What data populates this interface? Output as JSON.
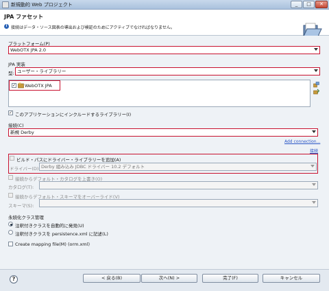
{
  "window": {
    "title": "新規動的 Web プロジェクト",
    "controls": {
      "minimize": "_",
      "maximize": "□",
      "close": "✕"
    }
  },
  "banner": {
    "title": "JPA ファセット",
    "message": "接続はデータ・ソース図表の導出および検証のためにアクティブでなければなりません。"
  },
  "platform": {
    "label": "プラットフォーム(P)",
    "value": "WebOTX JPA 2.0"
  },
  "implementation": {
    "group_label": "JPA 実装",
    "type_label": "型:",
    "type_value": "ユーザー・ライブラリー",
    "libraries": [
      {
        "name": "WebOTX JPA",
        "checked": true
      }
    ],
    "include_label": "このアプリケーションにインクルードするライブラリー(I)",
    "include_checked": true
  },
  "connection": {
    "label": "接続(C)",
    "value": "新規 Derby",
    "add_link": "Add connection...",
    "connect_link": "接続",
    "add_driver_label": "ビルド・パスにドライバー・ライブラリーを追加(A)",
    "driver_label": "ドライバー(D):",
    "driver_value": "Derby 組み込み JDBC ドライバー 10.2 デフォルト",
    "override_catalog_label": "接続からデフォルト・カタログを上書き(O)",
    "catalog_label": "カタログ(T):",
    "override_schema_label": "接続からデフォルト・スキーマをオーバーライド(V)",
    "schema_label": "スキーマ(S):"
  },
  "persistence": {
    "group_label": "永続化クラス管理",
    "options": [
      {
        "label": "注釈付きクラスを自動的に発見(U)",
        "selected": true
      },
      {
        "label": "注釈付きクラスを persistence.xml に記述(L)",
        "selected": false
      }
    ],
    "create_mapping_label": "Create mapping file(M) (orm.xml)",
    "create_mapping_checked": false
  },
  "buttons": {
    "help": "?",
    "back": "< 戻る(B)",
    "next": "次へ(N) >",
    "finish": "完了(F)",
    "cancel": "キャンセル"
  },
  "colors": {
    "highlight_border": "#c8102e",
    "link": "#2a56c6",
    "info": "#2b63b6"
  }
}
